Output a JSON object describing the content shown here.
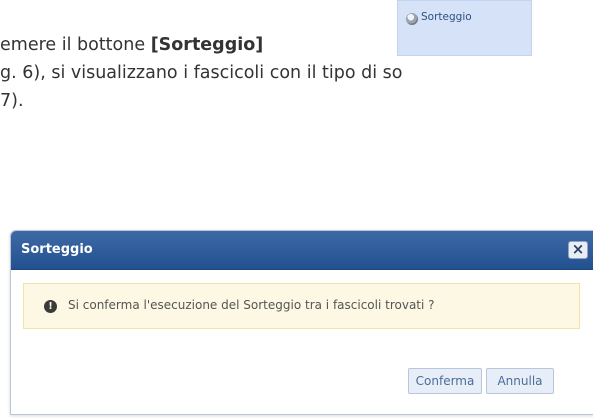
{
  "document": {
    "line1_prefix": "emere il bottone ",
    "line1_bold": "[Sorteggio]",
    "line2": "g. 6), si visualizzano i fascicoli con il tipo di so",
    "line3": "7)."
  },
  "inline_button": {
    "label": "Sorteggio",
    "icon": "sorteggio-icon"
  },
  "dialog": {
    "title": "Sorteggio",
    "close_glyph": "×",
    "message": "Si conferma l'esecuzione del Sorteggio tra i fascicoli trovati ?",
    "buttons": {
      "confirm": "Conferma",
      "cancel": "Annulla"
    }
  },
  "colors": {
    "header": "#2d5c9c",
    "alert_bg": "#fcf8e3",
    "button_text": "#4a6d9c"
  }
}
